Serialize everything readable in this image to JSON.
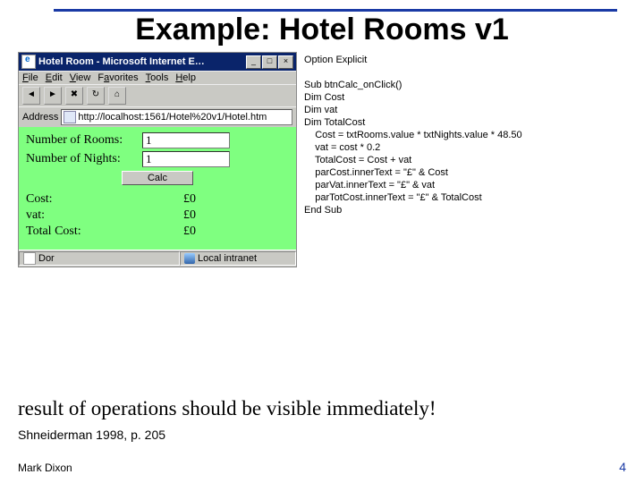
{
  "slide": {
    "title": "Example: Hotel Rooms v1",
    "conclusion": "result of operations should be visible immediately!",
    "citation": "Shneiderman 1998, p. 205",
    "footer_left": "Mark Dixon",
    "footer_right": "4"
  },
  "browser": {
    "titlebar": "Hotel Room - Microsoft Internet E…",
    "win_min": "_",
    "win_max": "□",
    "win_close": "×",
    "menu": {
      "file": "File",
      "edit": "Edit",
      "view": "View",
      "favorites": "Favorites",
      "tools": "Tools",
      "help": "Help"
    },
    "address_label": "Address",
    "address_value": "http://localhost:1561/Hotel%20v1/Hotel.htm",
    "status_left": "Dor",
    "status_right": "Local intranet"
  },
  "form": {
    "rooms_label": "Number of Rooms:",
    "rooms_value": "1",
    "nights_label": "Number of Nights:",
    "nights_value": "1",
    "calc_label": "Calc",
    "cost_label": "Cost:",
    "cost_value": "£0",
    "vat_label": "vat:",
    "vat_value": "£0",
    "total_label": "Total Cost:",
    "total_value": "£0"
  },
  "code": {
    "line1": "Option Explicit",
    "line2": "",
    "line3": "Sub btnCalc_onClick()",
    "line4": "Dim Cost",
    "line5": "Dim vat",
    "line6": "Dim TotalCost",
    "line7": "    Cost = txtRooms.value * txtNights.value * 48.50",
    "line8": "    vat = cost * 0.2",
    "line9": "    TotalCost = Cost + vat",
    "line10": "    parCost.innerText = \"£\" & Cost",
    "line11": "    parVat.innerText = \"£\" & vat",
    "line12": "    parTotCost.innerText = \"£\" & TotalCost",
    "line13": "End Sub"
  }
}
